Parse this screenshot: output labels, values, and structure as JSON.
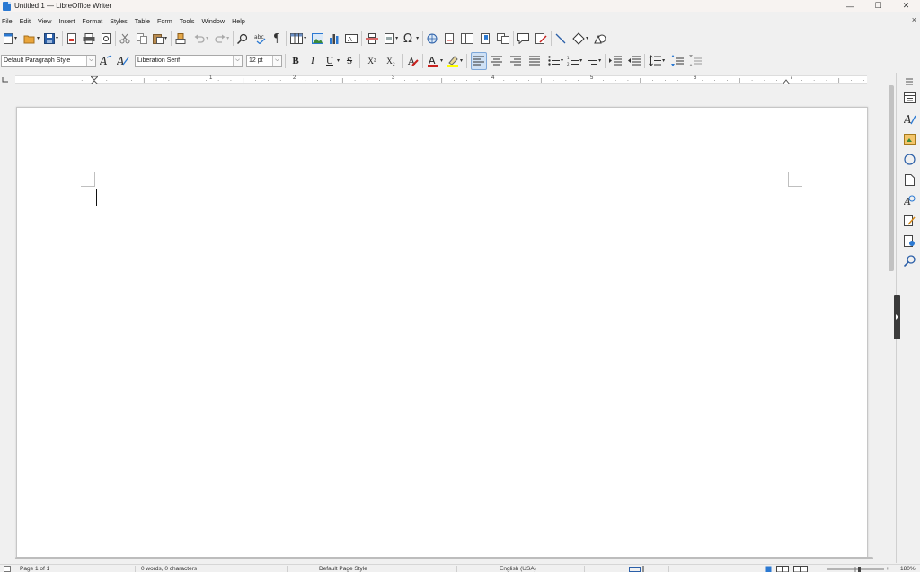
{
  "window": {
    "title": "Untitled 1 — LibreOffice Writer",
    "minimize_glyph": "—",
    "maximize_glyph": "☐",
    "close_glyph": "✕",
    "doc_close_glyph": "×"
  },
  "menu": [
    "File",
    "Edit",
    "View",
    "Insert",
    "Format",
    "Styles",
    "Table",
    "Form",
    "Tools",
    "Window",
    "Help"
  ],
  "formatting": {
    "paragraph_style": "Default Paragraph Style",
    "font_name": "Liberation Serif",
    "font_size": "12 pt",
    "bold": "B",
    "italic": "I",
    "underline": "U",
    "strikethrough": "S",
    "superscript": "X²",
    "subscript": "X₂"
  },
  "ruler": {
    "numbers": [
      "1",
      "2",
      "3",
      "4",
      "5",
      "6",
      "7"
    ]
  },
  "statusbar": {
    "page": "Page 1 of 1",
    "words": "0 words, 0 characters",
    "page_style": "Default Page Style",
    "language": "English (USA)",
    "zoom": "180%"
  },
  "colors": {
    "accent": "#2b79d2",
    "font_color_bar": "#c9211e",
    "highlight_bar": "#ffff00",
    "active_button": "#cfe1f5"
  },
  "icons": {
    "sidebar": [
      "sidebar-menu-icon",
      "properties-icon",
      "styles-icon",
      "gallery-icon",
      "navigator-icon",
      "page-icon",
      "style-inspector-icon",
      "manage-changes-icon",
      "design-icon",
      "find-icon"
    ]
  }
}
